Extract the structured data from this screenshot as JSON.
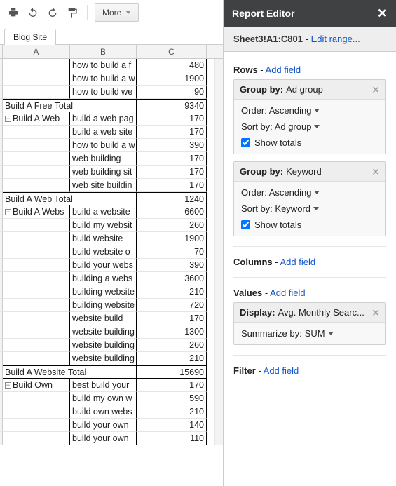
{
  "toolbar": {
    "more_label": "More"
  },
  "tabs": [
    "Blog Site"
  ],
  "columns": [
    "A",
    "B",
    "C"
  ],
  "rows": [
    {
      "a": "",
      "b": "how to build a f",
      "c": 480
    },
    {
      "a": "",
      "b": "how to build a w",
      "c": 1900
    },
    {
      "a": "",
      "b": "how to build we",
      "c": 90
    },
    {
      "total": true,
      "a": "Build A Free Total",
      "c": 9340
    },
    {
      "group": true,
      "a": "Build A Web",
      "b": "build a web pag",
      "c": 170
    },
    {
      "a": "",
      "b": "build a web site",
      "c": 170
    },
    {
      "a": "",
      "b": "how to build a w",
      "c": 390
    },
    {
      "a": "",
      "b": "web building",
      "c": 170
    },
    {
      "a": "",
      "b": "web building sit",
      "c": 170
    },
    {
      "a": "",
      "b": "web site buildin",
      "c": 170
    },
    {
      "total": true,
      "a": "Build A Web Total",
      "c": 1240
    },
    {
      "group": true,
      "a": "Build A Webs",
      "b": "build a website",
      "c": 6600
    },
    {
      "a": "",
      "b": "build my websit",
      "c": 260
    },
    {
      "a": "",
      "b": "build website",
      "c": 1900
    },
    {
      "a": "",
      "b": "build website o",
      "c": 70
    },
    {
      "a": "",
      "b": "build your webs",
      "c": 390
    },
    {
      "a": "",
      "b": "building a webs",
      "c": 3600
    },
    {
      "a": "",
      "b": "building website",
      "c": 210
    },
    {
      "a": "",
      "b": "building website",
      "c": 720
    },
    {
      "a": "",
      "b": "website build",
      "c": 170
    },
    {
      "a": "",
      "b": "website building",
      "c": 1300
    },
    {
      "a": "",
      "b": "website building",
      "c": 260
    },
    {
      "a": "",
      "b": "website building",
      "c": 210
    },
    {
      "total": true,
      "a": "Build A Website Total",
      "c": 15690
    },
    {
      "group": true,
      "a": "Build Own",
      "b": "best build your",
      "c": 170
    },
    {
      "a": "",
      "b": "build my own w",
      "c": 590
    },
    {
      "a": "",
      "b": "build own webs",
      "c": 210
    },
    {
      "a": "",
      "b": "build your own",
      "c": 140
    },
    {
      "a": "",
      "b": "build your own",
      "c": 110
    }
  ],
  "editor": {
    "title": "Report Editor",
    "range": "Sheet3!A1:C801",
    "edit_range": "Edit range...",
    "rows_label": "Rows",
    "add_field": "Add field",
    "groups": [
      {
        "by": "Ad group",
        "order": "Ascending",
        "sort": "Ad group",
        "show_totals": true
      },
      {
        "by": "Keyword",
        "order": "Ascending",
        "sort": "Keyword",
        "show_totals": true
      }
    ],
    "columns_label": "Columns",
    "values_label": "Values",
    "display": {
      "label": "Display:",
      "value": "Avg. Monthly Searc...",
      "summarize_label": "Summarize by:",
      "summarize": "SUM"
    },
    "filter_label": "Filter",
    "group_by_label": "Group by:",
    "order_label": "Order:",
    "sort_label": "Sort by:",
    "show_totals_label": "Show totals"
  }
}
